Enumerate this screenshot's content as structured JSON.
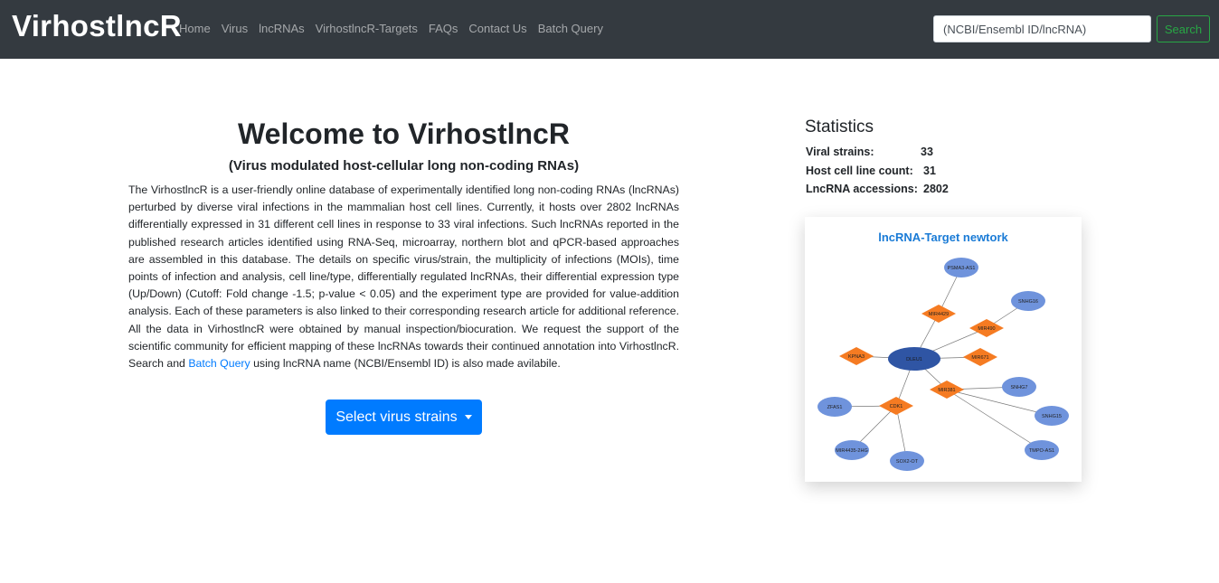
{
  "navbar": {
    "brand": "VirhostlncR",
    "links": [
      "Home",
      "Virus",
      "lncRNAs",
      "VirhostlncR-Targets",
      "FAQs",
      "Contact Us",
      "Batch Query"
    ],
    "search_placeholder": "(NCBI/Ensembl ID/lncRNA)",
    "search_button": "Search"
  },
  "main": {
    "title": "Welcome to VirhostlncR",
    "subtitle": "(Virus modulated host-cellular long non-coding RNAs)",
    "intro_before_link": "The VirhostlncR is a user-friendly online database of experimentally identified long non-coding RNAs (lncRNAs) perturbed by diverse viral infections in the mammalian host cell lines. Currently, it hosts over 2802 lncRNAs differentially expressed in 31 different cell lines in response to 33 viral infections. Such lncRNAs reported in the published research articles identified using RNA-Seq, microarray, northern blot and qPCR-based approaches are assembled in this database. The details on specific virus/strain, the multiplicity of infections (MOIs), time points of infection and analysis, cell line/type, differentially regulated lncRNAs, their differential expression type (Up/Down) (Cutoff: Fold change -1.5; p-value < 0.05) and the experiment type are provided for value-addition analysis. Each of these parameters is also linked to their corresponding research article for additional reference. All the data in VirhostlncR were obtained by manual inspection/biocuration. We request the support of the scientific community for efficient mapping of these lncRNAs towards their continued annotation into VirhostlncR. Search and ",
    "intro_link": "Batch Query",
    "intro_after_link": " using lncRNA name (NCBI/Ensembl ID) is also made avilabile.",
    "select_button": "Select virus strains"
  },
  "statistics": {
    "title": "Statistics",
    "rows": [
      {
        "label": "Viral strains:",
        "value": "33"
      },
      {
        "label": "Host cell line count:",
        "value": "31"
      },
      {
        "label": "LncRNA accessions:",
        "value": "2802"
      }
    ]
  },
  "network": {
    "title": "lncRNA-Target newtork",
    "colors": {
      "center": "#2f55a4",
      "lncrna": "#6f93dc",
      "target": "#f57b22",
      "edge": "#777777"
    },
    "nodes": [
      {
        "id": "DLEU1",
        "label": "DLEU1",
        "kind": "center"
      },
      {
        "id": "PSMA3-AS1",
        "label": "PSMA3-AS1",
        "kind": "lncrna"
      },
      {
        "id": "SNHG16",
        "label": "SNHG16",
        "kind": "lncrna"
      },
      {
        "id": "SNHG7",
        "label": "SNHG7",
        "kind": "lncrna"
      },
      {
        "id": "SNHG15",
        "label": "SNHG15",
        "kind": "lncrna"
      },
      {
        "id": "TMPO-AS1",
        "label": "TMPO-AS1",
        "kind": "lncrna"
      },
      {
        "id": "ZFAS1",
        "label": "ZFAS1",
        "kind": "lncrna"
      },
      {
        "id": "MIR4435-2HG",
        "label": "MIR4435-2HG",
        "kind": "lncrna"
      },
      {
        "id": "SOX2-OT",
        "label": "SOX2-OT",
        "kind": "lncrna"
      },
      {
        "id": "MIR4429",
        "label": "MIR4429",
        "kind": "target"
      },
      {
        "id": "MIR490",
        "label": "MIR490",
        "kind": "target"
      },
      {
        "id": "MIR671",
        "label": "MIR671",
        "kind": "target"
      },
      {
        "id": "MIR381",
        "label": "MIR381",
        "kind": "target"
      },
      {
        "id": "KPNA3",
        "label": "KPNA3",
        "kind": "target"
      },
      {
        "id": "CDK1",
        "label": "CDK1",
        "kind": "target"
      }
    ],
    "edges": [
      [
        "DLEU1",
        "MIR4429"
      ],
      [
        "MIR4429",
        "PSMA3-AS1"
      ],
      [
        "DLEU1",
        "MIR490"
      ],
      [
        "MIR490",
        "SNHG16"
      ],
      [
        "DLEU1",
        "MIR671"
      ],
      [
        "DLEU1",
        "KPNA3"
      ],
      [
        "DLEU1",
        "MIR381"
      ],
      [
        "MIR381",
        "SNHG7"
      ],
      [
        "MIR381",
        "SNHG15"
      ],
      [
        "MIR381",
        "TMPO-AS1"
      ],
      [
        "DLEU1",
        "CDK1"
      ],
      [
        "CDK1",
        "ZFAS1"
      ],
      [
        "CDK1",
        "MIR4435-2HG"
      ],
      [
        "CDK1",
        "SOX2-OT"
      ]
    ]
  }
}
